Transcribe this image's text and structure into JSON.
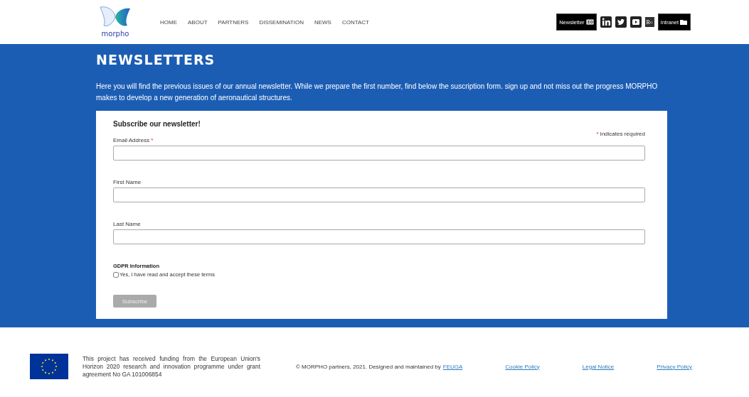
{
  "header": {
    "logo_text": "morpho",
    "nav": [
      {
        "label": "HOME"
      },
      {
        "label": "ABOUT"
      },
      {
        "label": "PARTNERS"
      },
      {
        "label": "DISSEMINATION"
      },
      {
        "label": "NEWS"
      },
      {
        "label": "CONTACT"
      }
    ],
    "social": [
      {
        "kind": "newsletter",
        "label": "Newsletter"
      },
      {
        "kind": "linkedin"
      },
      {
        "kind": "twitter"
      },
      {
        "kind": "youtube"
      },
      {
        "kind": "researchgate",
        "label": "R$^{G}$"
      },
      {
        "kind": "intranet",
        "label": "Intranet"
      }
    ]
  },
  "page": {
    "title": "NEWSLETTERS",
    "intro": "Here you will find the previous issues of our annual newsletter. While we prepare the first number, find below the suscription form. sign up and not miss out the progress MORPHO makes to develop a new generation of aeronautical structures."
  },
  "form": {
    "title": "Subscribe our newsletter!",
    "required_mark": "*",
    "required_note": "indicates required",
    "fields": [
      {
        "label": "Email Address",
        "required": true
      },
      {
        "label": "First Name",
        "required": false
      },
      {
        "label": "Last Name",
        "required": false
      }
    ],
    "gdpr_title": "GDPR Information",
    "consent": {
      "label": "Yes, I have read and accept these terms",
      "checked": false
    },
    "submit": {
      "label": "Subscribe",
      "disabled": true
    }
  },
  "footer": {
    "funding": "This project has received funding from the European Union's Horizon 2020 research and innovation programme under grant agreement No GA 101006854",
    "copyright": "© MORPHO partners, 2021. Designed and maintained by",
    "copyright_link": "FEUGA",
    "links": [
      "Cookie Policy",
      "Legal Notice",
      "Privacy Policy"
    ]
  }
}
